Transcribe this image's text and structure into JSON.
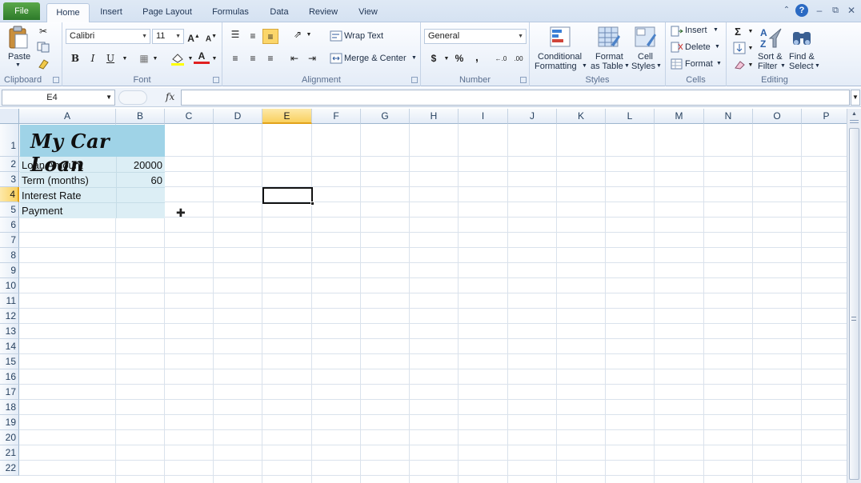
{
  "ribbon_tabs": [
    "File",
    "Home",
    "Insert",
    "Page Layout",
    "Formulas",
    "Data",
    "Review",
    "View"
  ],
  "clipboard": {
    "paste_label": "Paste",
    "group_label": "Clipboard"
  },
  "font": {
    "name": "Calibri",
    "size": "11",
    "group_label": "Font"
  },
  "alignment": {
    "wrap_text": "Wrap Text",
    "merge_center": "Merge & Center",
    "group_label": "Alignment"
  },
  "number": {
    "format": "General",
    "currency": "$",
    "percent": "%",
    "comma": ",",
    "group_label": "Number"
  },
  "styles": {
    "conditional_line1": "Conditional",
    "conditional_line2": "Formatting",
    "format_table_line1": "Format",
    "format_table_line2": "as Table",
    "cell_styles_line1": "Cell",
    "cell_styles_line2": "Styles",
    "group_label": "Styles"
  },
  "cells": {
    "insert": "Insert",
    "delete": "Delete",
    "format": "Format",
    "group_label": "Cells"
  },
  "editing": {
    "sort_line1": "Sort &",
    "sort_line2": "Filter",
    "find_line1": "Find &",
    "find_line2": "Select",
    "group_label": "Editing"
  },
  "formula_bar": {
    "name_box": "E4",
    "fx": "fx",
    "formula": ""
  },
  "columns": [
    "A",
    "B",
    "C",
    "D",
    "E",
    "F",
    "G",
    "H",
    "I",
    "J",
    "K",
    "L",
    "M",
    "N",
    "O",
    "P"
  ],
  "active_column": "E",
  "active_row": 4,
  "rows": [
    "1",
    "2",
    "3",
    "4",
    "5",
    "6",
    "7",
    "8",
    "9",
    "10",
    "11",
    "12",
    "13",
    "14",
    "15",
    "16",
    "17",
    "18",
    "19",
    "20",
    "21",
    "22"
  ],
  "sheet": {
    "title": "My Car Loan",
    "loan_amount_label": "Loan Amount",
    "loan_amount_value": "20000",
    "term_label": "Term (months)",
    "term_value": "60",
    "interest_label": "Interest Rate",
    "interest_value": "",
    "payment_label": "Payment",
    "payment_value": ""
  },
  "colors": {
    "title_fill": "#9fd3e7",
    "table_fill": "#dceef5",
    "file_tab": "#2d7a2a",
    "active_header": "#f9d05f"
  }
}
